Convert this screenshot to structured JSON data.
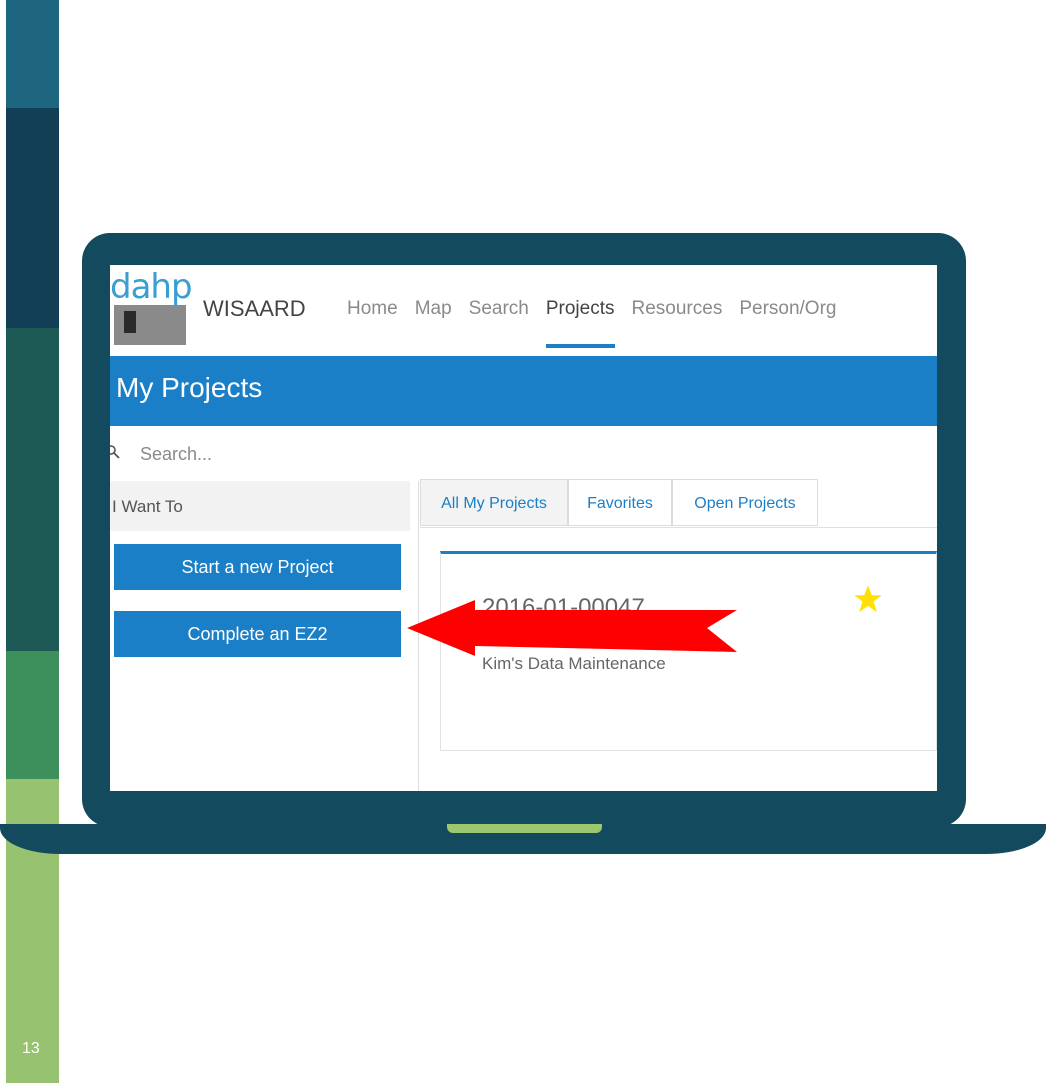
{
  "app": {
    "brand": "WISAARD",
    "logo_text": "dahp"
  },
  "nav": {
    "items": [
      {
        "label": "Home",
        "active": false
      },
      {
        "label": "Map",
        "active": false
      },
      {
        "label": "Search",
        "active": false
      },
      {
        "label": "Projects",
        "active": true
      },
      {
        "label": "Resources",
        "active": false
      },
      {
        "label": "Person/Org",
        "active": false
      }
    ]
  },
  "page": {
    "title": "My Projects"
  },
  "search": {
    "placeholder": "Search..."
  },
  "actions": {
    "heading": "I Want To",
    "start_label": "Start a new Project",
    "complete_label": "Complete an EZ2"
  },
  "tabs": [
    {
      "label": "All My Projects",
      "active": true
    },
    {
      "label": "Favorites",
      "active": false
    },
    {
      "label": "Open Projects",
      "active": false
    }
  ],
  "project_card": {
    "id": "2016-01-00047",
    "name": "Kim's Data Maintenance",
    "favorite": true
  },
  "slide": {
    "number": "13"
  },
  "colors": {
    "accent": "#1a7fc6",
    "laptop": "#144a5e",
    "arrow": "#ff0000",
    "star": "#ffd700"
  },
  "icons": {
    "search": "search-icon",
    "star": "star-icon",
    "arrow": "arrow-left-icon"
  }
}
